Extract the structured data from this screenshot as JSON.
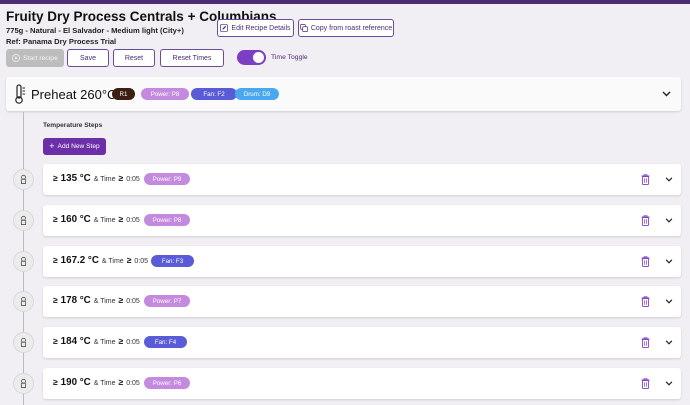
{
  "header": {
    "title": "Fruity Dry Process Centrals + Columbians",
    "subtitle": "775g - Natural - El Salvador - Medium light (City+)",
    "reference": "Ref: Panama Dry Process Trial",
    "edit_label": "Edit Recipe Details",
    "copy_label": "Copy from roast reference"
  },
  "toolbar": {
    "start_label": "Start recipe",
    "save_label": "Save",
    "reset_label": "Reset",
    "reset_times_label": "Reset Times",
    "toggle_label": "Time Toggle",
    "toggle_on": true
  },
  "preheat": {
    "label": "Preheat 260°C",
    "chips": [
      {
        "label": "R1",
        "color": "#3b1f12"
      },
      {
        "label": "Power: P8",
        "color": "#c48ae0"
      },
      {
        "label": "Fan: F2",
        "color": "#5a5bd6"
      },
      {
        "label": "Drum: D9",
        "color": "#4aa8f0"
      }
    ]
  },
  "steps_section": {
    "label": "Temperature Steps",
    "add_label": "Add New Step"
  },
  "steps": [
    {
      "temp": "135 °C",
      "and_time": "& Time",
      "time": "0:05",
      "chip": "Power: P9",
      "chip_color": "#c48ae0"
    },
    {
      "temp": "160 °C",
      "and_time": "& Time",
      "time": "0:05",
      "chip": "Power: P8",
      "chip_color": "#c48ae0"
    },
    {
      "temp": "167.2 °C",
      "and_time": "& Time",
      "time": "0:05",
      "chip": "Fan: F3",
      "chip_color": "#5a5bd6"
    },
    {
      "temp": "178 °C",
      "and_time": "& Time",
      "time": "0:05",
      "chip": "Power: P7",
      "chip_color": "#c48ae0"
    },
    {
      "temp": "184 °C",
      "and_time": "& Time",
      "time": "0:05",
      "chip": "Fan: F4",
      "chip_color": "#5a5bd6"
    },
    {
      "temp": "190 °C",
      "and_time": "& Time",
      "time": "0:05",
      "chip": "Power: P6",
      "chip_color": "#c48ae0"
    }
  ],
  "symbols": {
    "ge": "≥"
  }
}
